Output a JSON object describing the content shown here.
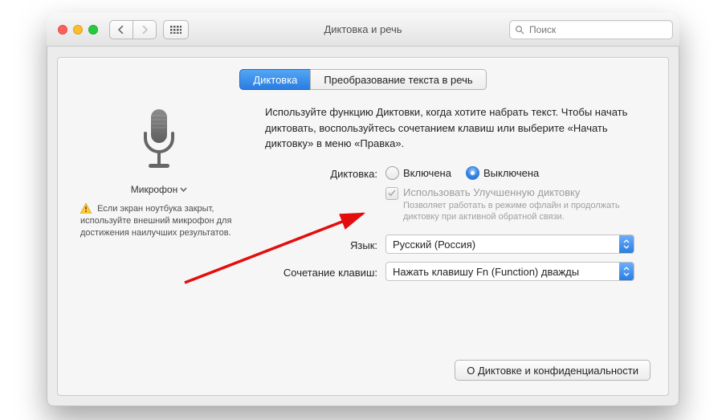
{
  "window": {
    "title": "Диктовка и речь"
  },
  "search": {
    "placeholder": "Поиск"
  },
  "tabs": [
    {
      "label": "Диктовка",
      "active": true
    },
    {
      "label": "Преобразование текста в речь",
      "active": false
    }
  ],
  "left": {
    "mic_label": "Микрофон",
    "warning": "Если экран ноутбука закрыт, используйте внешний микрофон для достижения наилучших результатов."
  },
  "right": {
    "description": "Используйте функцию Диктовки, когда хотите набрать текст. Чтобы начать диктовать, воспользуйтесь сочетанием клавиш или выберите «Начать диктовку» в меню «Правка».",
    "dictation_label": "Диктовка:",
    "radio_on": "Включена",
    "radio_off": "Выключена",
    "enhanced_label": "Использовать Улучшенную диктовку",
    "enhanced_sub": "Позволяет работать в режиме офлайн и продолжать диктовку при активной обратной связи.",
    "language_label": "Язык:",
    "language_value": "Русский (Россия)",
    "shortcut_label": "Сочетание клавиш:",
    "shortcut_value": "Нажать клавишу Fn (Function) дважды"
  },
  "footer": {
    "privacy": "О Диктовке и конфиденциальности"
  }
}
